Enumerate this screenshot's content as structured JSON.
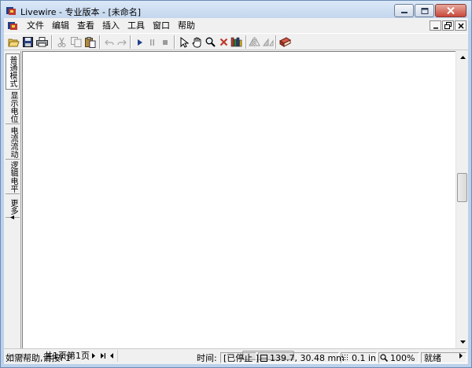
{
  "window": {
    "title": "Livewire - 专业版本  - [未命名]"
  },
  "menu": {
    "items": [
      "文件",
      "编辑",
      "查看",
      "插入",
      "工具",
      "窗口",
      "帮助"
    ]
  },
  "toolbar": {
    "buttons": [
      "open-icon",
      "save-icon",
      "print-icon",
      "cut-icon",
      "copy-icon",
      "paste-icon",
      "undo-icon",
      "redo-icon",
      "play-icon",
      "pause-icon",
      "stop-icon",
      "select-arrow-icon",
      "hand-pan-icon",
      "zoom-icon",
      "delete-x-icon",
      "parts-bin-icon",
      "flip-horizontal-icon",
      "flip-vertical-icon",
      "book-icon"
    ]
  },
  "left_tabs": {
    "tab1": "普通模式",
    "tab2": "显示电位",
    "tab3": "电流流动",
    "tab4": "逻辑电平",
    "more": "更多"
  },
  "page_nav": {
    "label": "共1页第1页"
  },
  "status": {
    "help": "如需帮助,请按F1",
    "time_label": "时间:",
    "state": "[已停止 ]",
    "coords": "139.7, 30.48 mm",
    "grid": "0.1 in",
    "zoom": "100%",
    "ready": "就绪"
  },
  "colors": {
    "title_gradient_top": "#dbe8f7",
    "title_gradient_bottom": "#bfd3ec",
    "close_button": "#c9483a",
    "canvas": "#ffffff"
  }
}
